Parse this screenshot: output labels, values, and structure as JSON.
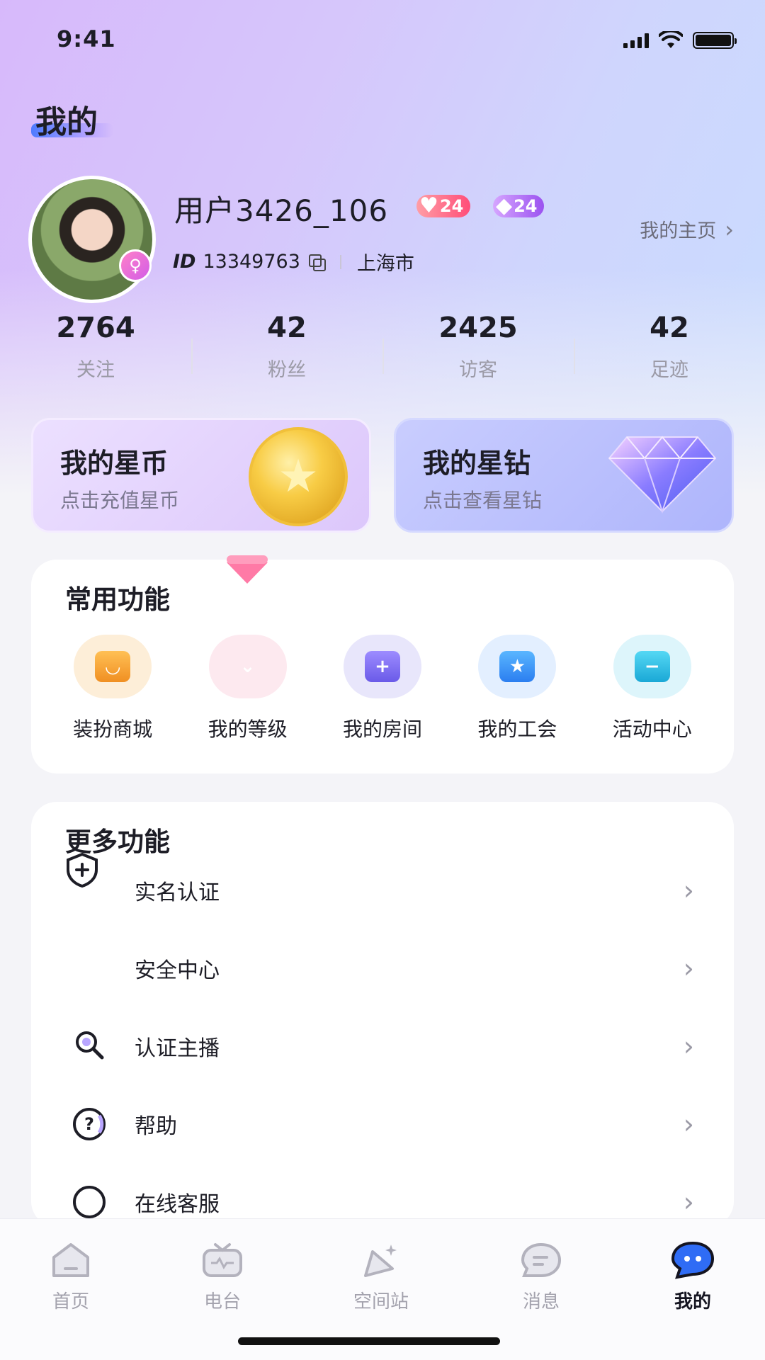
{
  "status_bar": {
    "time": "9:41"
  },
  "page": {
    "title": "我的"
  },
  "profile": {
    "username": "用户3426_106",
    "heart_level": "24",
    "diamond_level": "24",
    "id_label": "ID",
    "id_number": "13349763",
    "city": "上海市",
    "homepage_link": "我的主页"
  },
  "stats": [
    {
      "value": "2764",
      "label": "关注"
    },
    {
      "value": "42",
      "label": "粉丝"
    },
    {
      "value": "2425",
      "label": "访客"
    },
    {
      "value": "42",
      "label": "足迹"
    }
  ],
  "wallet": {
    "coin": {
      "title": "我的星币",
      "subtitle": "点击充值星币"
    },
    "diamond": {
      "title": "我的星钻",
      "subtitle": "点击查看星钻"
    }
  },
  "common_functions": {
    "title": "常用功能",
    "items": [
      {
        "label": "装扮商城",
        "icon": "shopping-bag-icon",
        "color": "#f6a53d"
      },
      {
        "label": "我的等级",
        "icon": "level-icon",
        "color": "#ffc4d6"
      },
      {
        "label": "我的房间",
        "icon": "room-icon",
        "color": "#7e72f1"
      },
      {
        "label": "我的工会",
        "icon": "guild-star-icon",
        "color": "#3b9cf6"
      },
      {
        "label": "活动中心",
        "icon": "activity-box-icon",
        "color": "#30c6e8"
      }
    ]
  },
  "more_functions": {
    "title": "更多功能",
    "items": [
      {
        "label": "实名认证",
        "icon": "shield-plus-icon"
      },
      {
        "label": "安全中心",
        "icon": "security-icon"
      },
      {
        "label": "认证主播",
        "icon": "search-person-icon"
      },
      {
        "label": "帮助",
        "icon": "question-icon"
      },
      {
        "label": "在线客服",
        "icon": "customer-service-icon"
      }
    ]
  },
  "tabbar": {
    "items": [
      {
        "label": "首页",
        "icon": "home-icon"
      },
      {
        "label": "电台",
        "icon": "radio-icon"
      },
      {
        "label": "空间站",
        "icon": "rocket-icon"
      },
      {
        "label": "消息",
        "icon": "message-icon"
      },
      {
        "label": "我的",
        "icon": "profile-bubble-icon"
      }
    ],
    "active": "我的"
  },
  "colors": {
    "accent": "#3b82f6",
    "heart": "#ff4d78",
    "diamond": "#9b52f0"
  }
}
